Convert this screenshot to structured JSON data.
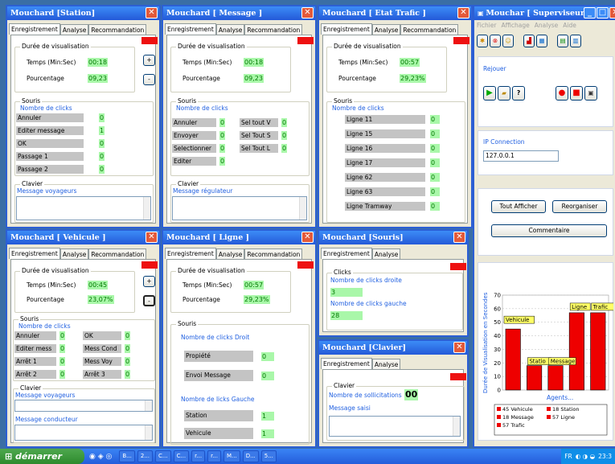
{
  "tabs": {
    "enr": "Enregistrement",
    "ana": "Analyse",
    "rec": "Recommandation"
  },
  "common": {
    "duree": "Durée de visualisation",
    "temps": "Temps (Min:Sec)",
    "pct": "Pourcentage",
    "souris": "Souris",
    "nbclicks": "Nombre de clicks",
    "clavier": "Clavier",
    "plus": "+",
    "minus": "-"
  },
  "station": {
    "title": "Mouchard [Station]",
    "time": "00:18",
    "pct": "09,23",
    "rows": [
      {
        "l": "Annuler",
        "v": "0"
      },
      {
        "l": "Editer message",
        "v": "1"
      },
      {
        "l": "OK",
        "v": "0"
      },
      {
        "l": "Passage 1",
        "v": "0"
      },
      {
        "l": "Passage 2",
        "v": "0"
      }
    ],
    "msg": "Message voyageurs"
  },
  "message": {
    "title": "Mouchard [ Message ]",
    "time": "00:18",
    "pct": "09,23",
    "left": [
      {
        "l": "Annuler",
        "v": "0"
      },
      {
        "l": "Envoyer",
        "v": "0"
      },
      {
        "l": "Selectionner",
        "v": "0"
      },
      {
        "l": "Editer",
        "v": "0"
      }
    ],
    "right": [
      {
        "l": "Sel tout V",
        "v": "0"
      },
      {
        "l": "Sel Tout S",
        "v": "0"
      },
      {
        "l": "Sel Tout L",
        "v": "0"
      }
    ],
    "msg": "Message régulateur"
  },
  "trafic": {
    "title": "Mouchard [ Etat Trafic ]",
    "time": "00:57",
    "pct": "29,23%",
    "rows": [
      {
        "l": "Ligne 11",
        "v": "0"
      },
      {
        "l": "Ligne 15",
        "v": "0"
      },
      {
        "l": "Ligne 16",
        "v": "0"
      },
      {
        "l": "Ligne 17",
        "v": "0"
      },
      {
        "l": "Ligne 62",
        "v": "0"
      },
      {
        "l": "Ligne 63",
        "v": "0"
      },
      {
        "l": "Ligne Tramway",
        "v": "0"
      }
    ]
  },
  "vehicule": {
    "title": "Mouchard [ Vehicule ]",
    "time": "00:45",
    "pct": "23,07%",
    "left": [
      {
        "l": "Annuler",
        "v": "0"
      },
      {
        "l": "Editer mess",
        "v": "0"
      },
      {
        "l": "Arrêt 1",
        "v": "0"
      },
      {
        "l": "Arrêt 2",
        "v": "0"
      }
    ],
    "right": [
      {
        "l": "OK",
        "v": "0"
      },
      {
        "l": "Mess Cond",
        "v": "0"
      },
      {
        "l": "Mess Voy",
        "v": "0"
      },
      {
        "l": "Arrêt 3",
        "v": "0"
      }
    ],
    "msg1": "Message voyageurs",
    "msg2": "Message conducteur"
  },
  "ligne": {
    "title": "Mouchard [ Ligne ]",
    "time": "00:57",
    "pct": "29,23%",
    "droit": "Nombre de clicks Droit",
    "gauche": "Nombre de licks Gauche",
    "r1": {
      "l": "Propiété",
      "v": "0"
    },
    "r2": {
      "l": "Envoi Message",
      "v": "0"
    },
    "r3": {
      "l": "Station",
      "v": "1"
    },
    "r4": {
      "l": "Vehicule",
      "v": "1"
    }
  },
  "souris": {
    "title": "Mouchard [Souris]",
    "clicks": "Clicks",
    "droite": "Nombre de clicks droite",
    "dv": "3",
    "gauche": "Nombre de clicks gauche",
    "gv": "28"
  },
  "clavier": {
    "title": "Mouchard [Clavier]",
    "soll": "Nombre de sollicitations",
    "sv": "00",
    "saisi": "Message saisi"
  },
  "sup": {
    "title": "Mouchar [ Superviseur ]",
    "menu": [
      "Fichier",
      "Affichage",
      "Analyse",
      "Aide"
    ],
    "rejouer": "Rejouer",
    "ip": "IP Connection",
    "ipval": "127.0.0.1",
    "tout": "Tout Afficher",
    "reorg": "Reorganiser",
    "comment": "Commentaire"
  },
  "chart_data": {
    "type": "bar",
    "categories": [
      "Vehicule",
      "Station",
      "Message",
      "Ligne",
      "Trafic"
    ],
    "values": [
      45,
      18,
      18,
      57,
      57
    ],
    "ylabel": "Durée de Visualisation en Secondes",
    "xlabel": "Agents...",
    "ylim": [
      0,
      70
    ],
    "yticks": [
      0,
      10,
      20,
      30,
      40,
      50,
      60,
      70
    ],
    "color": "#ee0000",
    "legend": [
      "45 Vehicule",
      "18 Station",
      "18 Message",
      "57 Ligne",
      "57 Trafic"
    ],
    "annotations": [
      "Vehicule",
      "Statio",
      "Message",
      "Ligne",
      "Trafic"
    ]
  },
  "taskbar": {
    "start": "démarrer",
    "items": [
      "B...",
      "2...",
      "C...",
      "C...",
      "r...",
      "r...",
      "M...",
      "D...",
      "5..."
    ],
    "lang": "FR",
    "clock": "23:3"
  }
}
